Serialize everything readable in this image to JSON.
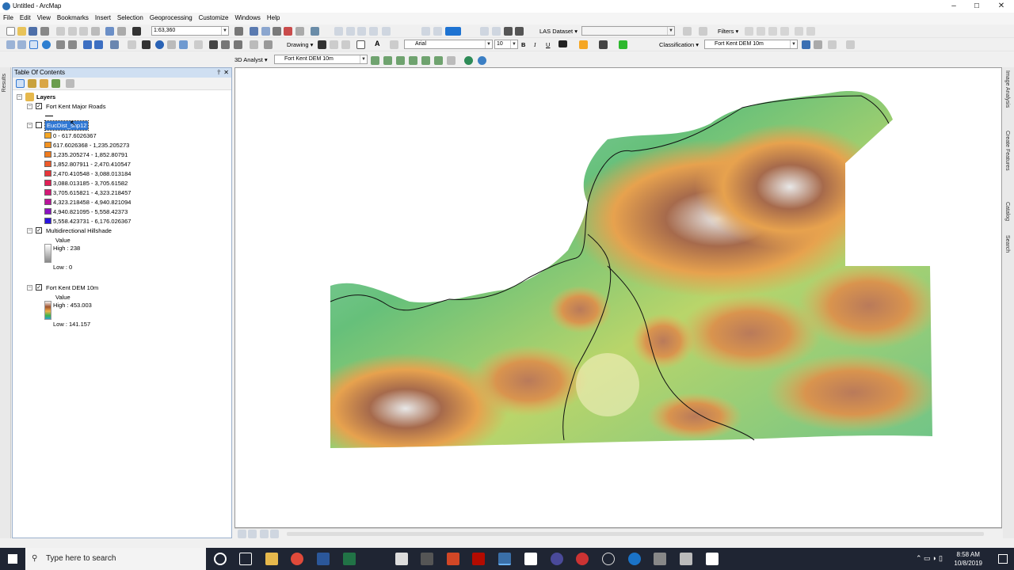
{
  "window": {
    "title": "Untitled - ArcMap",
    "min": "–",
    "max": "☐",
    "close": "✕"
  },
  "menu": [
    "File",
    "Edit",
    "View",
    "Bookmarks",
    "Insert",
    "Selection",
    "Geoprocessing",
    "Customize",
    "Windows",
    "Help"
  ],
  "toolbar": {
    "scale": "1:63,360",
    "drawing_label": "Drawing ▾",
    "font_name": "Arial",
    "font_size": "10",
    "bold": "B",
    "italic": "I",
    "underline": "U",
    "text_tool": "A",
    "las_label": "LAS Dataset ▾",
    "filters_label": "Filters ▾",
    "analyst_label": "3D Analyst ▾",
    "analyst_layer": "Fort Kent DEM 10m",
    "classification_label": "Classification ▾",
    "classification_layer": "Fort Kent DEM 10m"
  },
  "toc": {
    "title": "Table Of Contents",
    "pin": "ᵖ",
    "close": "✕",
    "root": "Layers",
    "layers": [
      {
        "name": "Fort Kent Major Roads",
        "checked": true
      },
      {
        "name": "EucDist_shp12",
        "checked": false,
        "classes": [
          {
            "label": "0 - 617.6026367",
            "color": "#f5a623"
          },
          {
            "label": "617.6026368 - 1,235.205273",
            "color": "#f39220"
          },
          {
            "label": "1,235.205274 - 1,852.80791",
            "color": "#f07c1e"
          },
          {
            "label": "1,852.807911 - 2,470.410547",
            "color": "#ee5a2a"
          },
          {
            "label": "2,470.410548 - 3,088.013184",
            "color": "#e9363a"
          },
          {
            "label": "3,088.013185 - 3,705.61582",
            "color": "#e11f55"
          },
          {
            "label": "3,705.615821 - 4,323.218457",
            "color": "#d41976"
          },
          {
            "label": "4,323.218458 - 4,940.821094",
            "color": "#b8149a"
          },
          {
            "label": "4,940.821095 - 5,558.42373",
            "color": "#8b12c2"
          },
          {
            "label": "5,558.423731 - 6,176.026367",
            "color": "#2b14e0"
          }
        ]
      },
      {
        "name": "Multidirectional Hillshade",
        "checked": true,
        "value": "Value",
        "high": "High : 238",
        "low": "Low : 0"
      },
      {
        "name": "Fort Kent DEM 10m",
        "checked": true,
        "value": "Value",
        "high": "High : 453.003",
        "low": "Low : 141.157"
      }
    ]
  },
  "side_tabs": {
    "left": "Results",
    "right": [
      "Image Analysis",
      "Create Features",
      "Catalog",
      "Search"
    ]
  },
  "taskbar": {
    "search_placeholder": "Type here to search",
    "time": "8:58 AM",
    "date": "10/8/2019"
  },
  "colors": {
    "accent": "#2a6fb5",
    "selection": "#3178d4",
    "taskbar": "#1f2533"
  }
}
